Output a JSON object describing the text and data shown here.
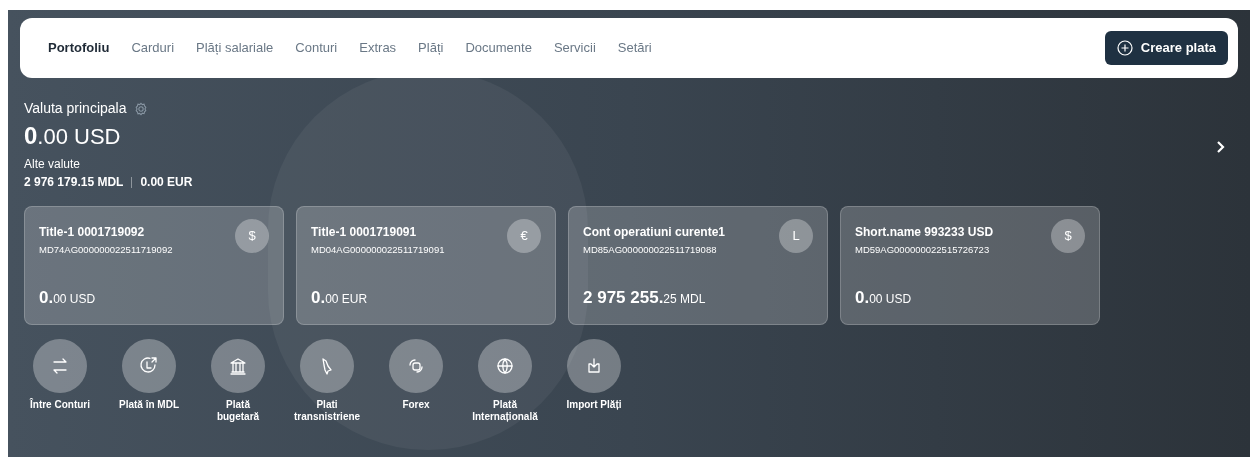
{
  "nav": {
    "tabs": [
      {
        "label": "Portofoliu",
        "selected": true
      },
      {
        "label": "Carduri",
        "selected": false
      },
      {
        "label": "Plăți salariale",
        "selected": false
      },
      {
        "label": "Conturi",
        "selected": false
      },
      {
        "label": "Extras",
        "selected": false
      },
      {
        "label": "Plăți",
        "selected": false
      },
      {
        "label": "Documente",
        "selected": false
      },
      {
        "label": "Servicii",
        "selected": false
      },
      {
        "label": "Setări",
        "selected": false
      }
    ],
    "create_button": "Creare plata"
  },
  "main_currency": {
    "label": "Valuta principala",
    "integer": "0",
    "fraction": ".00 USD"
  },
  "other_currencies": {
    "label": "Alte valute",
    "values": [
      "2 976 179.15 MDL",
      "0.00 EUR"
    ]
  },
  "accounts": [
    {
      "title": "Title-1 0001719092",
      "iban": "MD74AG000000022511719092",
      "symbol": "$",
      "integer": "0.",
      "fraction": "00 USD"
    },
    {
      "title": "Title-1 0001719091",
      "iban": "MD04AG000000022511719091",
      "symbol": "€",
      "integer": "0.",
      "fraction": "00 EUR"
    },
    {
      "title": "Cont operatiuni curente1",
      "iban": "MD85AG000000022511719088",
      "symbol": "L",
      "integer": "2 975 255.",
      "fraction": "25 MDL"
    },
    {
      "title": "Short.name 993233 USD",
      "iban": "MD59AG000000022515726723",
      "symbol": "$",
      "integer": "0.",
      "fraction": "00 USD"
    }
  ],
  "actions": [
    {
      "label": "Între Conturi",
      "kind": "transfer"
    },
    {
      "label": "Plată în MDL",
      "kind": "clock"
    },
    {
      "label": "Plată bugetară",
      "kind": "bank"
    },
    {
      "label": "Plati transnistriene",
      "kind": "map"
    },
    {
      "label": "Forex",
      "kind": "exchange"
    },
    {
      "label": "Plată Internațională",
      "kind": "globe"
    },
    {
      "label": "Import Plăți",
      "kind": "import"
    }
  ]
}
